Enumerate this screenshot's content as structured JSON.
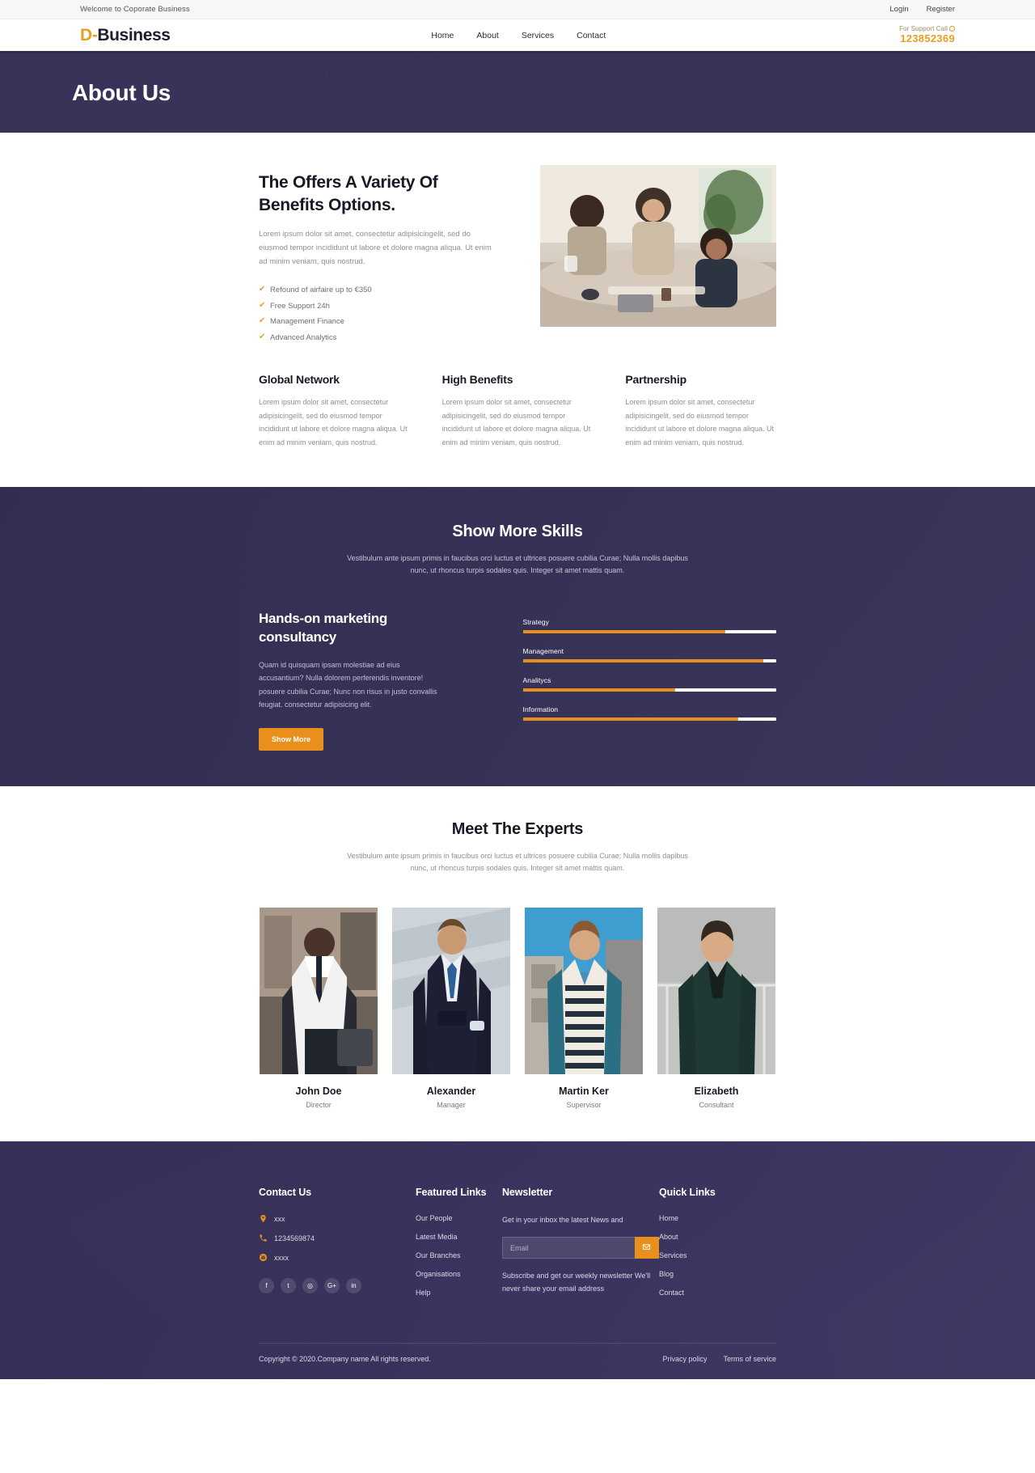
{
  "topbar": {
    "welcome": "Welcome to Coporate Business",
    "login": "Login",
    "register": "Register"
  },
  "header": {
    "logo_d": "D",
    "logo_dash": "-",
    "logo_rest": "Business",
    "nav": [
      {
        "label": "Home"
      },
      {
        "label": "About"
      },
      {
        "label": "Services"
      },
      {
        "label": "Contact"
      }
    ],
    "support_label": "For Support Call",
    "support_number": "123852369"
  },
  "hero": {
    "title": "About Us"
  },
  "about": {
    "heading": "The Offers A Variety Of Benefits Options.",
    "lead": "Lorem ipsum dolor sit amet, consectetur adipisicingelit, sed do eiusmod tempor incididunt ut labore et dolore magna aliqua. Ut enim ad minim veniam, quis nostrud.",
    "benefits": [
      "Refound of airfaire up to €350",
      "Free Support 24h",
      "Management Finance",
      "Advanced Analytics"
    ],
    "columns": [
      {
        "title": "Global Network",
        "text": "Lorem ipsum dolor sit amet, consectetur adipisicingelit, sed do eiusmod tempor incididunt ut labore et dolore magna aliqua. Ut enim ad minim veniam, quis nostrud."
      },
      {
        "title": "High Benefits",
        "text": "Lorem ipsum dolor sit amet, consectetur adipisicingelit, sed do eiusmod tempor incididunt ut labore et dolore magna aliqua. Ut enim ad minim veniam, quis nostrud."
      },
      {
        "title": "Partnership",
        "text": "Lorem ipsum dolor sit amet, consectetur adipisicingelit, sed do eiusmod tempor incididunt ut labore et dolore magna aliqua. Ut enim ad minim veniam, quis nostrud."
      }
    ]
  },
  "skills": {
    "title": "Show More Skills",
    "subtitle": "Vestibulum ante ipsum primis in faucibus orci luctus et ultrices posuere cubilia Curae; Nulla mollis dapibus nunc, ut rhoncus turpis sodales quis. Integer sit amet mattis quam.",
    "left_heading": "Hands-on marketing consultancy",
    "left_text": "Quam id quisquam ipsam molestiae ad eius accusantium? Nulla dolorem perferendis inventore! posuere cubilia Curae; Nunc non risus in justo convallis feugiat. consectetur adipisicing elit.",
    "button": "Show More",
    "bars": [
      {
        "label": "Strategy",
        "value": 80
      },
      {
        "label": "Management",
        "value": 95
      },
      {
        "label": "Analitycs",
        "value": 60
      },
      {
        "label": "Information",
        "value": 85
      }
    ]
  },
  "experts": {
    "title": "Meet The Experts",
    "subtitle": "Vestibulum ante ipsum primis in faucibus orci luctus et ultrices posuere cubilia Curae; Nulla mollis dapibus nunc, ut rhoncus turpis sodales quis. Integer sit amet mattis quam.",
    "members": [
      {
        "name": "John Doe",
        "role": "Director"
      },
      {
        "name": "Alexander",
        "role": "Manager"
      },
      {
        "name": "Martin Ker",
        "role": "Supervisor"
      },
      {
        "name": "Elizabeth",
        "role": "Consultant"
      }
    ]
  },
  "footer": {
    "contact": {
      "title": "Contact Us",
      "address": "xxx",
      "phone": "1234569874",
      "email": "xxxx",
      "socials": [
        "facebook-icon",
        "twitter-icon",
        "instagram-icon",
        "google-plus-icon",
        "linkedin-icon"
      ],
      "social_glyphs": [
        "f",
        "t",
        "◎",
        "G+",
        "in"
      ]
    },
    "featured": {
      "title": "Featured Links",
      "links": [
        "Our People",
        "Latest Media",
        "Our Branches",
        "Organisations",
        "Help"
      ]
    },
    "newsletter": {
      "title": "Newsletter",
      "description": "Get in your inbox the latest News and",
      "placeholder": "Email",
      "input_value": "",
      "note": "Subscribe and get our weekly newsletter We'll never share your email address"
    },
    "quick": {
      "title": "Quick Links",
      "links": [
        "Home",
        "About",
        "Services",
        "Blog",
        "Contact"
      ]
    },
    "copyright": "Copyright © 2020.Company name All rights reserved.",
    "legal": [
      "Privacy policy",
      "Terms of service"
    ]
  },
  "colors": {
    "accent": "#e8901b",
    "dark": "#373258",
    "logo_accent": "#e8a020"
  }
}
